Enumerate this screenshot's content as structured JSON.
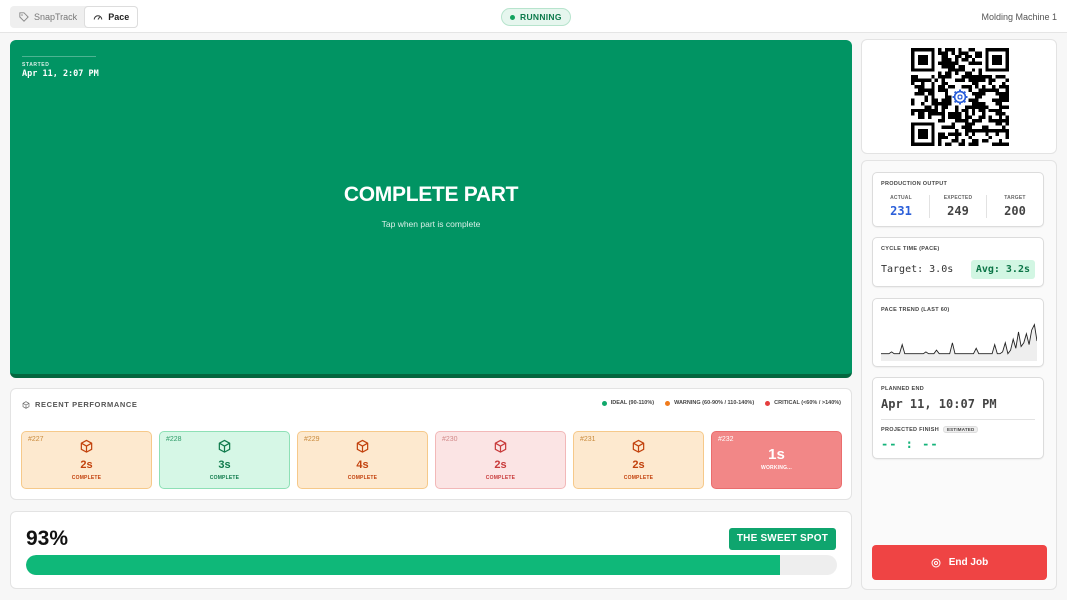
{
  "header": {
    "tabs": [
      {
        "label": "SnapTrack",
        "icon": "tag-icon",
        "active": false
      },
      {
        "label": "Pace",
        "icon": "gauge-icon",
        "active": true
      }
    ],
    "status": "RUNNING",
    "machine": "Molding Machine 1"
  },
  "job": {
    "started_label": "STARTED",
    "started_time": "Apr 11, 2:07 PM",
    "action_title": "COMPLETE PART",
    "action_hint": "Tap when part is complete"
  },
  "recent": {
    "title": "RECENT PERFORMANCE",
    "legend": [
      {
        "label": "IDEAL (90-110%)",
        "color": "#10a86b"
      },
      {
        "label": "WARNING (60-90% / 110-140%)",
        "color": "#f07b1c"
      },
      {
        "label": "CRITICAL (<60% / >140%)",
        "color": "#e53e3e"
      }
    ],
    "cards": [
      {
        "num": "#227",
        "value": "2s",
        "status": "COMPLETE",
        "level": "warn"
      },
      {
        "num": "#228",
        "value": "3s",
        "status": "COMPLETE",
        "level": "ideal"
      },
      {
        "num": "#229",
        "value": "4s",
        "status": "COMPLETE",
        "level": "warn"
      },
      {
        "num": "#230",
        "value": "2s",
        "status": "COMPLETE",
        "level": "crit"
      },
      {
        "num": "#231",
        "value": "2s",
        "status": "COMPLETE",
        "level": "warn"
      },
      {
        "num": "#232",
        "value": "1s",
        "status": "WORKING...",
        "level": "working"
      }
    ]
  },
  "efficiency": {
    "percent_label": "93%",
    "percent": 93,
    "badge": "THE SWEET SPOT",
    "bar_color": "#0fb879"
  },
  "qr": {
    "icon": "gear-icon"
  },
  "production": {
    "title": "PRODUCTION OUTPUT",
    "actual_label": "ACTUAL",
    "actual": "231",
    "expected_label": "EXPECTED",
    "expected": "249",
    "target_label": "TARGET",
    "target": "200"
  },
  "cycle": {
    "title": "CYCLE TIME (PACE)",
    "target": "Target: 3.0s",
    "avg": "Avg: 3.2s"
  },
  "trend": {
    "title": "PACE TREND (LAST 60)",
    "values": [
      3,
      3,
      3,
      3,
      3.1,
      3,
      3,
      3,
      3.5,
      3,
      3,
      3,
      3,
      3,
      3,
      3,
      3,
      3.1,
      3,
      3,
      3,
      3.2,
      3,
      3,
      3,
      3,
      3,
      3.6,
      3,
      3,
      3,
      3,
      3,
      3,
      3,
      3,
      3.3,
      3,
      3,
      3,
      3,
      3,
      3,
      3.5,
      3,
      3,
      3.1,
      3.6,
      3,
      3.2,
      3.8,
      3.3,
      4.2,
      3.4,
      3.6,
      4.1,
      3.5,
      4.3,
      4.6,
      3.7
    ]
  },
  "planned": {
    "title": "PLANNED END",
    "time": "Apr 11, 10:07 PM",
    "projected_label": "PROJECTED FINISH",
    "estimated_badge": "ESTIMATED",
    "projected": "-- : --"
  },
  "end_button": "End Job"
}
